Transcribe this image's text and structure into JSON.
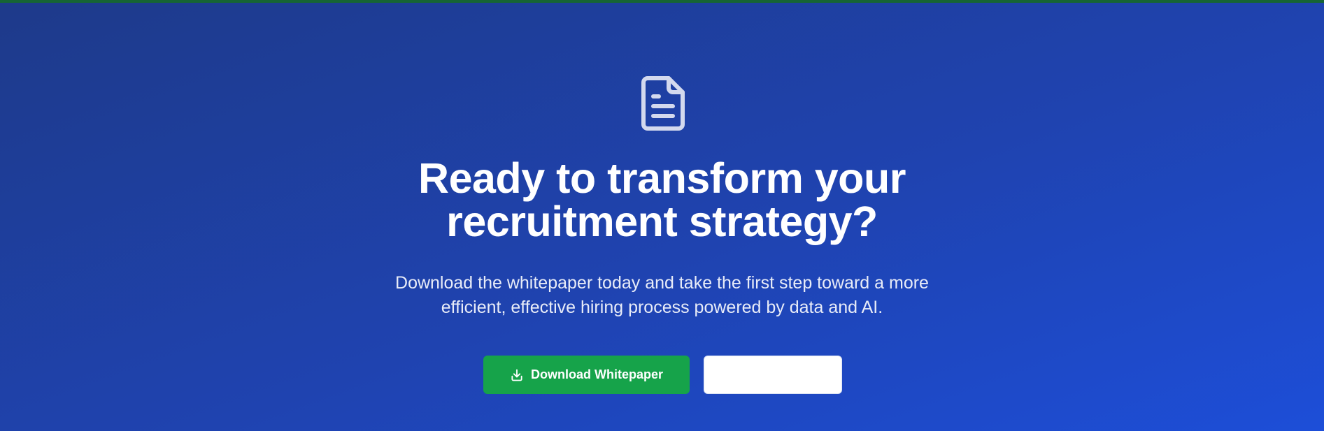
{
  "hero": {
    "icon": "document-icon",
    "headline_line1": "Ready to transform your",
    "headline_line2": "recruitment strategy?",
    "subtext_line1": "Download the whitepaper today and take the first step toward a more",
    "subtext_line2": "efficient, effective hiring process powered by data and AI.",
    "primary_button": {
      "label": "Download Whitepaper",
      "icon": "download-icon"
    },
    "secondary_button": {
      "label": ""
    }
  },
  "colors": {
    "background_start": "#1e3a8a",
    "background_end": "#1d4ed8",
    "top_border": "#166534",
    "primary_button": "#16a34a",
    "secondary_button": "#ffffff"
  }
}
